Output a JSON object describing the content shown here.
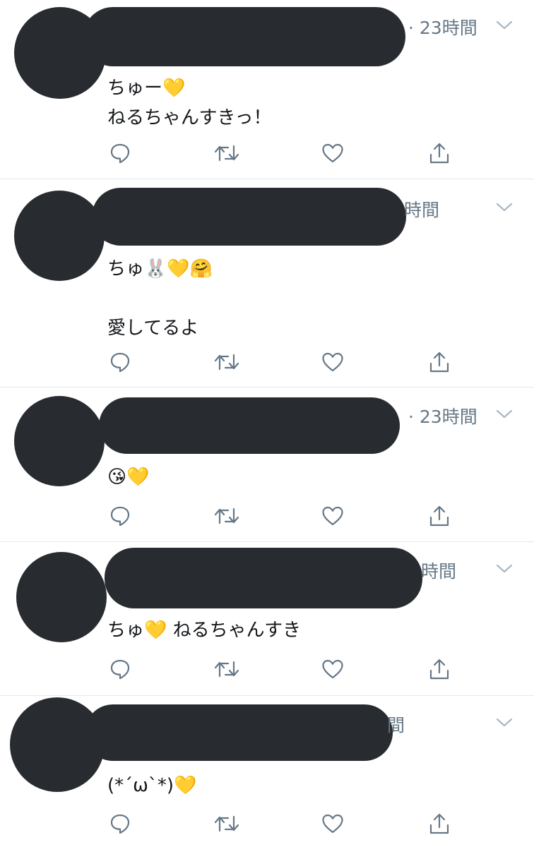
{
  "tweets": [
    {
      "time": "· 23時間",
      "lines": [
        "ちゅー💛",
        "ねるちゃんすきっ！"
      ]
    },
    {
      "time": "時間",
      "lines": [
        "ちゅ🐰💛🤗",
        "",
        "愛してるよ"
      ]
    },
    {
      "time": "· 23時間",
      "lines": [
        "😘💛"
      ]
    },
    {
      "time": "時間",
      "lines": [
        "ちゅ💛 ねるちゃんすき"
      ]
    },
    {
      "time": "間",
      "lines": [
        "(*´ω`*)💛"
      ]
    }
  ],
  "icons": {
    "reply": "speech-bubble-icon",
    "retweet": "retweet-arrows-icon",
    "like": "heart-icon",
    "share": "share-upload-icon",
    "caret": "chevron-down-icon"
  },
  "colors": {
    "icon": "#657786",
    "text": "#14171a",
    "divider": "#e1e8ed",
    "redaction": "#282c31"
  }
}
